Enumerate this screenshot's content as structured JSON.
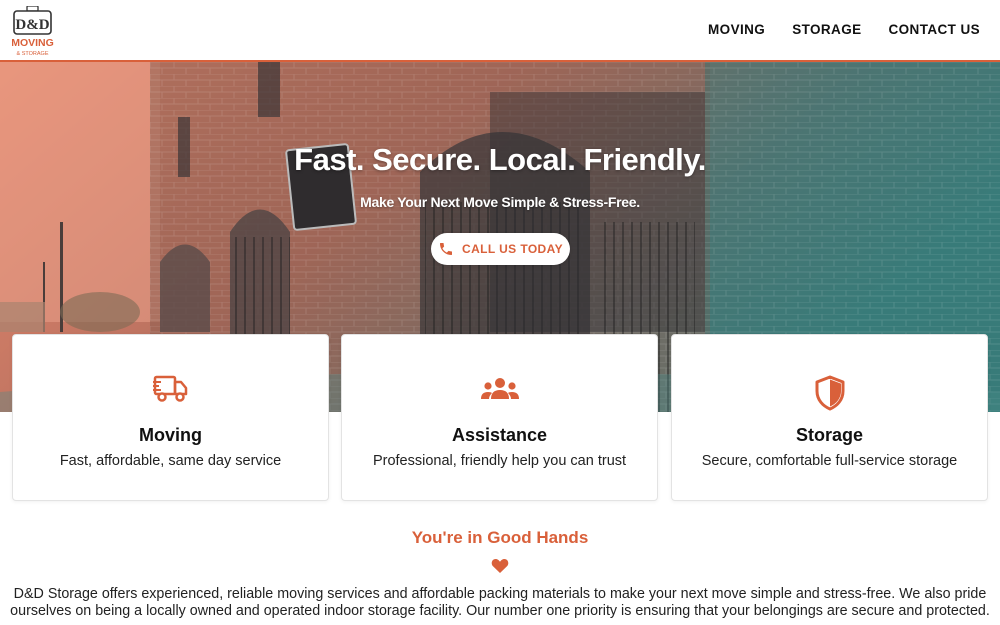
{
  "brand": {
    "logo_line1": "D&D",
    "logo_line2": "MOVING",
    "logo_line3": "& STORAGE",
    "accent_color": "#d9603a"
  },
  "nav": {
    "items": [
      {
        "label": "MOVING"
      },
      {
        "label": "STORAGE"
      },
      {
        "label": "CONTACT US"
      }
    ]
  },
  "hero": {
    "title": "Fast. Secure. Local. Friendly.",
    "subtitle": "Make Your Next Move Simple & Stress-Free.",
    "cta_label": "CALL US TODAY",
    "cta_icon": "phone-icon"
  },
  "cards": [
    {
      "icon": "truck-icon",
      "title": "Moving",
      "desc": "Fast, affordable, same day service"
    },
    {
      "icon": "people-icon",
      "title": "Assistance",
      "desc": "Professional, friendly help you can trust"
    },
    {
      "icon": "shield-icon",
      "title": "Storage",
      "desc": "Secure, comfortable full-service storage"
    }
  ],
  "about": {
    "title": "You're in Good Hands",
    "icon": "heart-icon",
    "text": "D&D Storage offers experienced, reliable moving services and affordable packing materials to make your next move simple and stress-free. We also pride ourselves on being a locally owned and operated indoor storage facility. Our number one priority is ensuring that your belongings are secure and protected."
  }
}
